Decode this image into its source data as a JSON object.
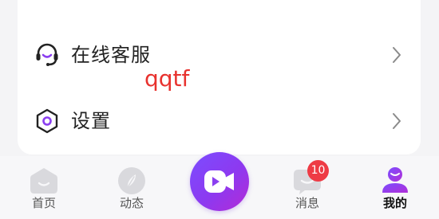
{
  "menu": {
    "items": [
      {
        "label": "在线客服",
        "icon": "headset-icon"
      },
      {
        "label": "设置",
        "icon": "settings-icon"
      }
    ]
  },
  "watermark": "qqtf",
  "tabbar": {
    "tabs": [
      {
        "label": "首页",
        "icon": "home-icon",
        "active": false
      },
      {
        "label": "动态",
        "icon": "feed-icon",
        "active": false
      },
      {
        "label": "",
        "icon": "video-camera-icon",
        "center": true
      },
      {
        "label": "消息",
        "icon": "message-icon",
        "active": false,
        "badge": "10"
      },
      {
        "label": "我的",
        "icon": "profile-icon",
        "active": true
      }
    ]
  },
  "colors": {
    "accent": "#8b3ff0",
    "accent_light": "#7b4dff",
    "badge": "#ee3b45",
    "watermark": "#e8322e",
    "inactive_icon": "#d9d9dd"
  }
}
